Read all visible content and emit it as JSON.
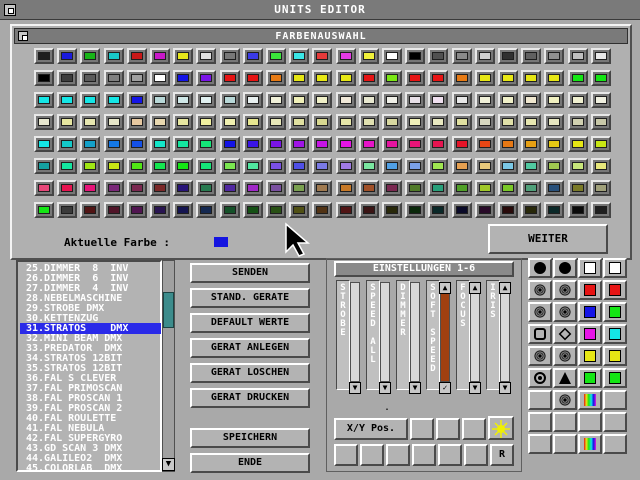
{
  "window": {
    "title": "UNITS EDITOR"
  },
  "palette": {
    "title": "FARBENAUSWAHL",
    "current_label": "Aktuelle Farbe :",
    "current_color": "#1414e0",
    "next_button": "WEITER",
    "rows": [
      [
        "#1e1e1e",
        "#1a1adc",
        "#18b418",
        "#18c8c8",
        "#c81818",
        "#c818c8",
        "#e6e61a",
        "#e0e0e0",
        "#787878",
        "#3a3ae6",
        "#3ae63a",
        "#3ae6e6",
        "#e63a3a",
        "#e63ae6",
        "#f0f03a",
        "#ffffff",
        "#000000",
        "#505050",
        "#8a8a8a",
        "#d0d0d0",
        "#303030",
        "#606060",
        "#909090",
        "#c0c0c0",
        "#e8e8e8"
      ],
      [
        "#000000",
        "#3c3c3c",
        "#5a5a5a",
        "#808080",
        "#a0a0a0",
        "#ffffff",
        "#1414e6",
        "#7a14e6",
        "#e61414",
        "#e61414",
        "#e67a14",
        "#e6e614",
        "#e6e614",
        "#e6e614",
        "#e61414",
        "#7ae614",
        "#e61414",
        "#e61414",
        "#e67a14",
        "#e6e614",
        "#e6e614",
        "#e6e614",
        "#e6e614",
        "#14e614",
        "#14e614"
      ],
      [
        "#14e6e6",
        "#14e6e6",
        "#14e6e6",
        "#14e6e6",
        "#1414e6",
        "#b8d8d8",
        "#d0e8e8",
        "#e0f0f0",
        "#b8d8d8",
        "#e8f0f0",
        "#f0f0d8",
        "#f0f0b8",
        "#f0f0c8",
        "#f0e8d8",
        "#e8e8d0",
        "#f0f0e8",
        "#e8e0e8",
        "#f0e0f0",
        "#e8e8e8",
        "#f0f0d8",
        "#f0f0c8",
        "#f0e8d0",
        "#f0f0c0",
        "#f0f0d0",
        "#f0f0e0"
      ],
      [
        "#e8e8d0",
        "#e6e6a0",
        "#e6e6b0",
        "#e6e6c8",
        "#e6c8a0",
        "#e8d8b0",
        "#e6e6a0",
        "#f0f0a0",
        "#f0f0b0",
        "#e6e690",
        "#e8e8b8",
        "#e0e0a0",
        "#d8d890",
        "#e6e6a8",
        "#e0e0b0",
        "#d8d8a0",
        "#f0f0b8",
        "#e8e8c0",
        "#e0e0a0",
        "#d8d8c0",
        "#e0e0a8",
        "#e6e6b0",
        "#e6e6c0",
        "#d0d0b0",
        "#c8c8a8"
      ],
      [
        "#14e6e6",
        "#14c8c8",
        "#14a0c8",
        "#1478e6",
        "#1450e6",
        "#14e6c8",
        "#14e6a0",
        "#14e678",
        "#1414e6",
        "#3a14e6",
        "#7a14e6",
        "#a014e6",
        "#c814e6",
        "#e614e6",
        "#e614c8",
        "#e614a0",
        "#e61478",
        "#e61450",
        "#e61428",
        "#e64614",
        "#e67814",
        "#e6a014",
        "#e6c814",
        "#e6e614",
        "#c8e614"
      ],
      [
        "#14a0a0",
        "#14e6a0",
        "#a0e614",
        "#c8e614",
        "#50e614",
        "#14e650",
        "#14e614",
        "#14e678",
        "#7ae650",
        "#50e6a0",
        "#7a50e6",
        "#5050e6",
        "#7a7ae6",
        "#a07ae6",
        "#7ae6a0",
        "#50a0e6",
        "#7aa0e6",
        "#a0e650",
        "#e6a050",
        "#e6c87a",
        "#7ac8e6",
        "#50c8a0",
        "#a0c850",
        "#c8e67a",
        "#e6e67a"
      ],
      [
        "#e64678",
        "#e61450",
        "#e61478",
        "#7a2878",
        "#7a2850",
        "#7a2828",
        "#281478",
        "#287a50",
        "#5028a0",
        "#a028c8",
        "#7a50a0",
        "#7aa050",
        "#a07a50",
        "#c87a28",
        "#a05028",
        "#7a2850",
        "#507a28",
        "#28a07a",
        "#50a028",
        "#a0c828",
        "#7ac828",
        "#50a07a",
        "#28507a",
        "#7a7a28",
        "#a0a07a"
      ],
      [
        "#14e614",
        "#3a3a3a",
        "#501414",
        "#501428",
        "#501450",
        "#281450",
        "#141450",
        "#142850",
        "#145028",
        "#145014",
        "#285014",
        "#505014",
        "#503214",
        "#501414",
        "#3a1414",
        "#28280a",
        "#0a280a",
        "#0a2828",
        "#0a0a28",
        "#280a28",
        "#280a0a",
        "#28280a",
        "#0a2828",
        "#0a0a0a",
        "#1e1e1e"
      ]
    ]
  },
  "units_list": {
    "items": [
      "25.DIMMER  8  INV",
      "26.DIMMER  6  INV",
      "27.DIMMER  4  INV",
      "28.NEBELMASCHINE",
      "29.STROBE DMX",
      "30.KETTENZUG",
      "31.STRATOS    DMX",
      "32.MINI BEAM DMX",
      "33.PREDATOR  DMX",
      "34.STRATOS 12BIT",
      "35.STRATOS 12BIT",
      "36.FAL S CLEVER",
      "37.FAL PRIMOSCAN",
      "38.FAL PROSCAN 1",
      "39.FAL PROSCAN 2",
      "40.FAL ROULETTE",
      "41.FAL NEBULA",
      "42.FAL SUPERGYRO",
      "43.GD SCAN 3 DMX",
      "44.GALILEO2  DMX",
      "45.COLORLAB  DMX"
    ],
    "selected_index": 6,
    "scroll_down": "▼"
  },
  "actions": {
    "send": "SENDEN",
    "standard_devices": "STAND. GERATE",
    "default_values": "DEFAULT WERTE",
    "create_device": "GERAT ANLEGEN",
    "delete_device": "GERAT LOSCHEN",
    "print_device": "GERAT DRUCKEN",
    "save": "SPEICHERN",
    "end": "ENDE"
  },
  "settings": {
    "title": "EINSTELLUNGEN 1-6",
    "channels": [
      {
        "label": "S\nT\nR\nO\nB\nE",
        "level": 0,
        "up": "",
        "down": "▼"
      },
      {
        "label": "S\nP\nE\nE\nD\n \nA\nL\nL",
        "level": 0,
        "up": "",
        "down": "▼"
      },
      {
        "label": "D\nI\nM\nM\nE\nR",
        "level": 0,
        "up": "",
        "down": "▼"
      },
      {
        "label": "S\nO\nF\nT\n \nS\nP\nE\nE\nD",
        "level": 1,
        "up": "▲",
        "down": "✓"
      },
      {
        "label": "F\nO\nC\nU\nS",
        "level": 0,
        "up": "▲",
        "down": "▼"
      },
      {
        "label": "I\nR\nI\nS",
        "level": 0,
        "up": "▲",
        "down": "▼"
      }
    ],
    "xy_button": "X/Y Pos.",
    "r_button": "R",
    "dot": "."
  },
  "tools": {
    "icons": [
      "filled-circle-icon",
      "filled-circle-icon",
      "white-square-icon",
      "white-square-icon",
      "splat-icon",
      "globe-icon",
      "red-square-icon",
      "red-square-icon",
      "burst-icon",
      "stars-icon",
      "blue-square-icon",
      "green-square-icon",
      "hexagon-icon",
      "diamond-icon",
      "magenta-square-icon",
      "cyan-square-icon",
      "asterisk-icon",
      "spiral-icon",
      "yellow-square-icon",
      "yellow-square-icon",
      "target-icon",
      "triangle-icon",
      "green-square-icon",
      "green-square-icon",
      "blank-icon",
      "swirl-icon",
      "rainbow-square-icon",
      "blank-icon",
      "blank-icon",
      "blank-icon",
      "blank-icon",
      "blank-icon",
      "blank-icon",
      "blank-icon",
      "rainbow-square-icon",
      "blank-icon"
    ]
  }
}
